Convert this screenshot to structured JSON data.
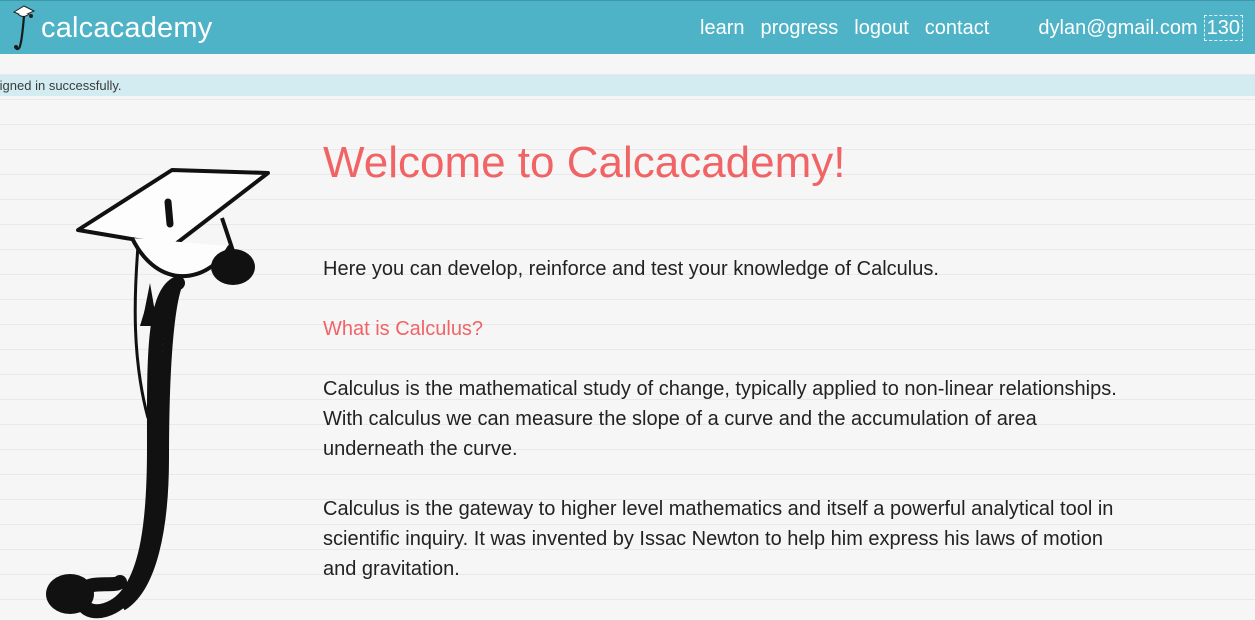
{
  "navbar": {
    "brand": "calcacademy",
    "links": [
      {
        "label": "learn"
      },
      {
        "label": "progress"
      },
      {
        "label": "logout"
      },
      {
        "label": "contact"
      }
    ],
    "user_email": "dylan@gmail.com",
    "points": "130"
  },
  "flash": {
    "message": "Signed in successfully."
  },
  "main": {
    "title": "Welcome to Calcacademy!",
    "intro": "Here you can develop, reinforce and test your knowledge of Calculus.",
    "subheading": "What is Calculus?",
    "paragraphs": [
      "Calculus is the mathematical study of change, typically applied to non-linear relationships. With calculus we can measure the slope of a curve and the accumulation of area underneath the curve.",
      "Calculus is the gateway to higher level mathematics and itself a powerful analytical tool in scientific inquiry. It was invented by Issac Newton to help him express his laws of motion and gravitation."
    ]
  },
  "colors": {
    "navbar": "#4eb3c6",
    "accent": "#f06466",
    "flash_bg": "#d2ecf1"
  },
  "icons": {
    "brand_logo": "integral-graduation-cap-icon",
    "hero_logo": "integral-graduation-cap-illustration"
  }
}
